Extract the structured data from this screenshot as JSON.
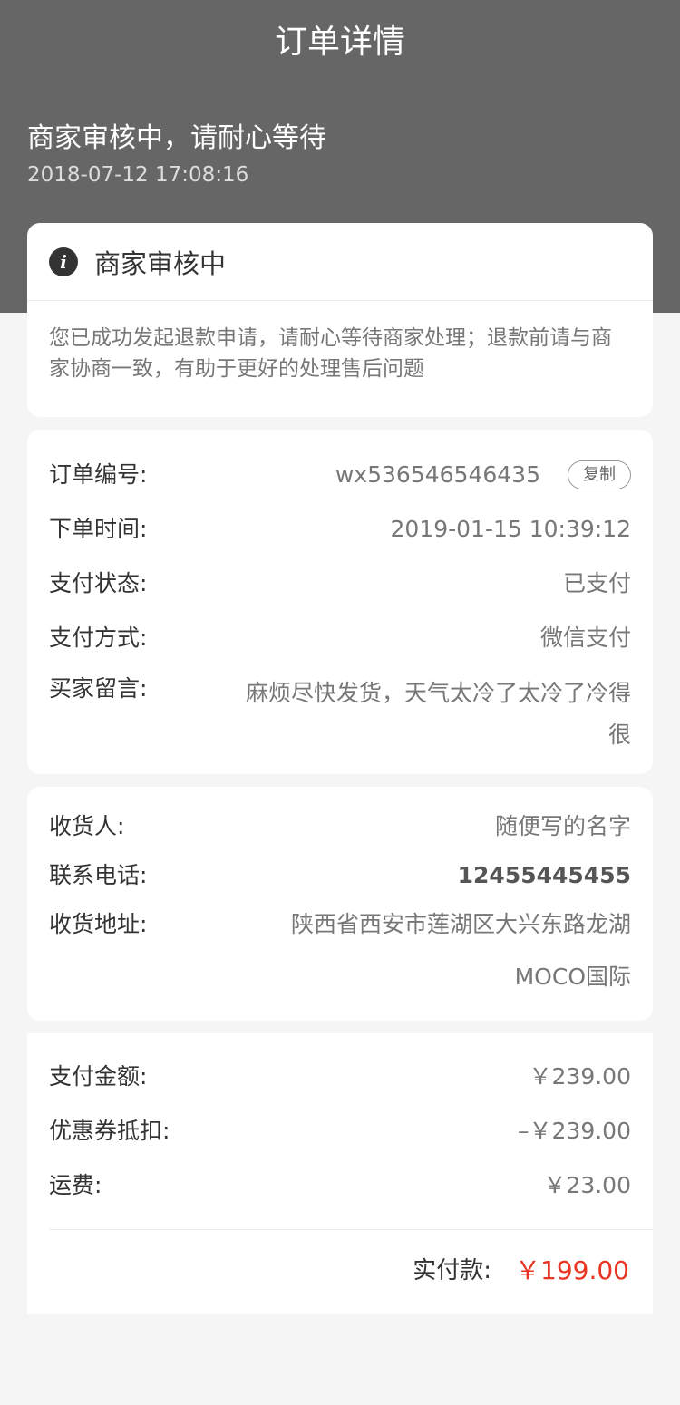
{
  "header": {
    "title": "订单详情",
    "status": "商家审核中，请耐心等待",
    "status_time": "2018-07-12  17:08:16"
  },
  "notice": {
    "icon": "info-icon",
    "title": "商家审核中",
    "body": "您已成功发起退款申请，请耐心等待商家处理；退款前请与商家协商一致，有助于更好的处理售后问题"
  },
  "order": {
    "number_label": "订单编号:",
    "number_value": "wx536546546435",
    "copy_label": "复制",
    "time_label": "下单时间:",
    "time_value": "2019-01-15 10:39:12",
    "pay_status_label": "支付状态:",
    "pay_status_value": "已支付",
    "pay_method_label": "支付方式:",
    "pay_method_value": "微信支付",
    "message_label": "买家留言:",
    "message_value": "麻烦尽快发货，天气太冷了太冷了冷得很"
  },
  "address": {
    "receiver_label": "收货人:",
    "receiver_value": "随便写的名字",
    "phone_label": "联系电话:",
    "phone_value": "12455445455",
    "addr_label": "收货地址:",
    "addr_value": "陕西省西安市莲湖区大兴东路龙湖MOCO国际"
  },
  "amount": {
    "pay_label": "支付金额:",
    "pay_value": "￥239.00",
    "coupon_label": "优惠券抵扣:",
    "coupon_value": "–￥239.00",
    "freight_label": "运费:",
    "freight_value": "￥23.00",
    "total_label": "实付款:",
    "total_value": "￥199.00"
  },
  "colors": {
    "header_bg": "#666666",
    "accent_red": "#e93323",
    "page_bg": "#f5f5f5"
  }
}
